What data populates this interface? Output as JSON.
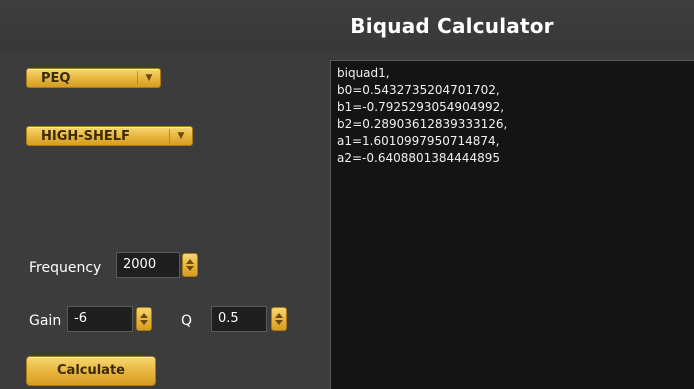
{
  "app": {
    "title": "Biquad Calculator"
  },
  "controls": {
    "filter_family": "PEQ",
    "filter_type": "HIGH-SHELF",
    "frequency_label": "Frequency",
    "frequency_value": "2000",
    "gain_label": "Gain",
    "gain_value": "-6",
    "q_label": "Q",
    "q_value": "0.5",
    "calculate_label": "Calculate"
  },
  "output": {
    "text": "biquad1,\nb0=0.5432735204701702,\nb1=-0.7925293054904992,\nb2=0.28903612839333126,\na1=1.6010997950714874,\na2=-0.6408801384444895"
  },
  "colors": {
    "accent": "#e6b43b",
    "background": "#3c3c3c",
    "output_background": "#141414"
  }
}
